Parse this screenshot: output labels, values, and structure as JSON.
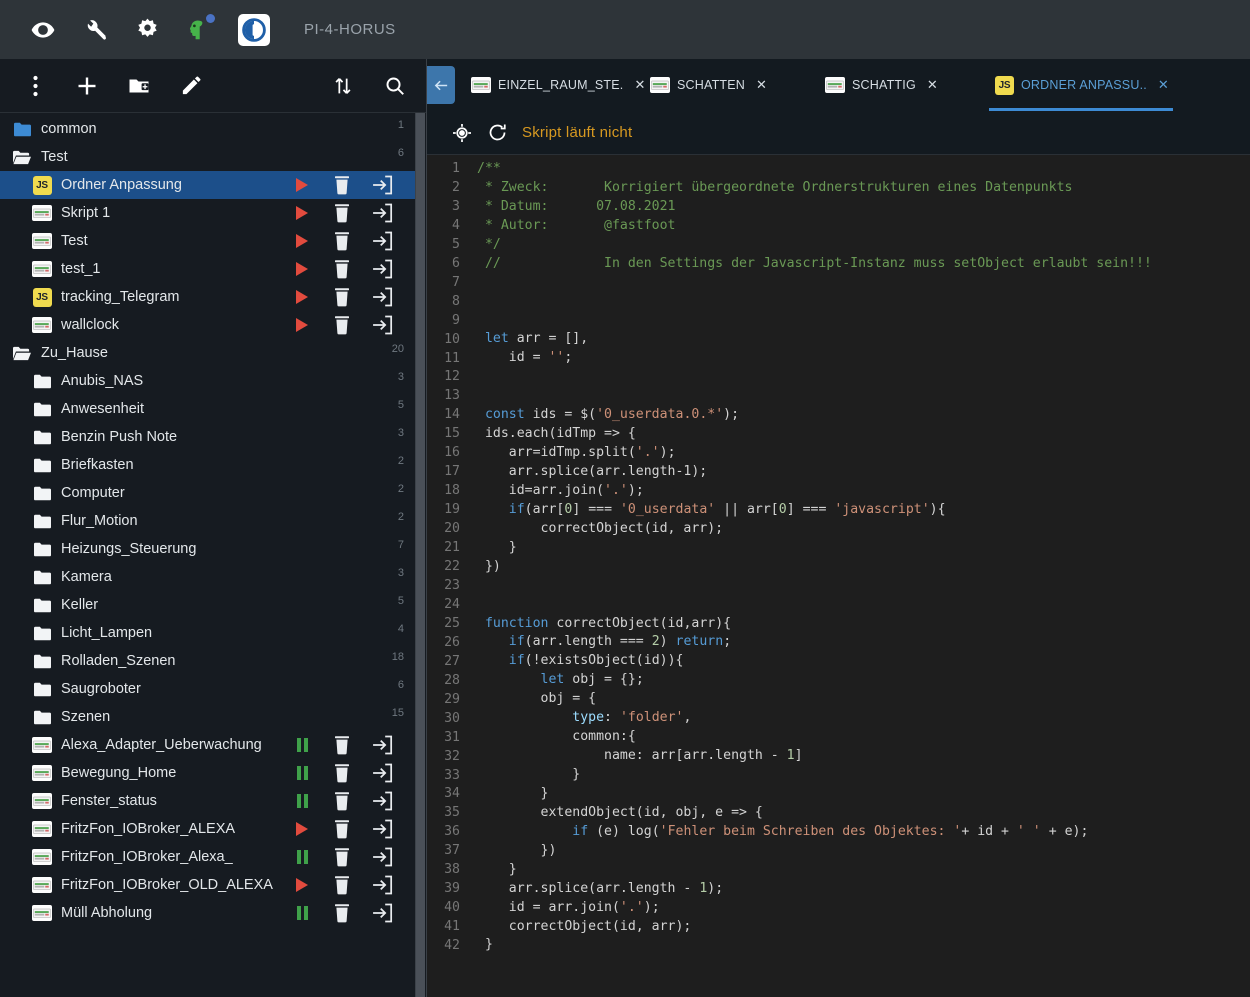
{
  "appbar": {
    "title": "PI-4-HORUS",
    "icons": [
      {
        "name": "eye-icon",
        "label": "eye"
      },
      {
        "name": "wrench-icon",
        "label": "wrench"
      },
      {
        "name": "gear-icon",
        "label": "gear"
      },
      {
        "name": "brain-icon",
        "label": "expert-mode"
      }
    ],
    "logo_label": "iobroker-logo"
  },
  "sidebar": {
    "toolbar": [
      {
        "name": "more-vert-icon",
        "label": "More options"
      },
      {
        "name": "add-icon",
        "label": "Add script"
      },
      {
        "name": "add-folder-icon",
        "label": "New folder"
      },
      {
        "name": "edit-icon",
        "label": "Rename"
      },
      {
        "name": "sort-icon",
        "label": "Sort"
      },
      {
        "name": "search-icon",
        "label": "Search"
      }
    ],
    "tree": [
      {
        "label": "common",
        "type": "folder-closed",
        "depth": 0,
        "count": "1",
        "actions": []
      },
      {
        "label": "Test",
        "type": "folder-open",
        "depth": 0,
        "count": "6",
        "actions": []
      },
      {
        "label": "Ordner Anpassung",
        "type": "js",
        "depth": 1,
        "count": "",
        "selected": true,
        "actions": [
          "play",
          "delete",
          "export"
        ]
      },
      {
        "label": "Skript 1",
        "type": "blockly",
        "depth": 1,
        "count": "",
        "actions": [
          "play",
          "delete",
          "export"
        ]
      },
      {
        "label": "Test",
        "type": "blockly",
        "depth": 1,
        "count": "",
        "actions": [
          "play",
          "delete",
          "export"
        ]
      },
      {
        "label": "test_1",
        "type": "blockly",
        "depth": 1,
        "count": "",
        "actions": [
          "play",
          "delete",
          "export"
        ]
      },
      {
        "label": "tracking_Telegram",
        "type": "js",
        "depth": 1,
        "count": "",
        "actions": [
          "play",
          "delete",
          "export"
        ]
      },
      {
        "label": "wallclock",
        "type": "blockly",
        "depth": 1,
        "count": "",
        "actions": [
          "play",
          "delete",
          "export"
        ]
      },
      {
        "label": "Zu_Hause",
        "type": "folder-open",
        "depth": 0,
        "count": "20",
        "actions": []
      },
      {
        "label": "Anubis_NAS",
        "type": "folder-closed-white",
        "depth": 1,
        "count": "3",
        "actions": []
      },
      {
        "label": "Anwesenheit",
        "type": "folder-closed-white",
        "depth": 1,
        "count": "5",
        "actions": []
      },
      {
        "label": "Benzin Push Note",
        "type": "folder-closed-white",
        "depth": 1,
        "count": "3",
        "actions": []
      },
      {
        "label": "Briefkasten",
        "type": "folder-closed-white",
        "depth": 1,
        "count": "2",
        "actions": []
      },
      {
        "label": "Computer",
        "type": "folder-closed-white",
        "depth": 1,
        "count": "2",
        "actions": []
      },
      {
        "label": "Flur_Motion",
        "type": "folder-closed-white",
        "depth": 1,
        "count": "2",
        "actions": []
      },
      {
        "label": "Heizungs_Steuerung",
        "type": "folder-closed-white",
        "depth": 1,
        "count": "7",
        "actions": []
      },
      {
        "label": "Kamera",
        "type": "folder-closed-white",
        "depth": 1,
        "count": "3",
        "actions": []
      },
      {
        "label": "Keller",
        "type": "folder-closed-white",
        "depth": 1,
        "count": "5",
        "actions": []
      },
      {
        "label": "Licht_Lampen",
        "type": "folder-closed-white",
        "depth": 1,
        "count": "4",
        "actions": []
      },
      {
        "label": "Rolladen_Szenen",
        "type": "folder-closed-white",
        "depth": 1,
        "count": "18",
        "actions": []
      },
      {
        "label": "Saugroboter",
        "type": "folder-closed-white",
        "depth": 1,
        "count": "6",
        "actions": []
      },
      {
        "label": "Szenen",
        "type": "folder-closed-white",
        "depth": 1,
        "count": "15",
        "actions": []
      },
      {
        "label": "Alexa_Adapter_Ueberwachung",
        "type": "blockly",
        "depth": 1,
        "count": "",
        "actions": [
          "pause",
          "delete",
          "export"
        ]
      },
      {
        "label": "Bewegung_Home",
        "type": "blockly",
        "depth": 1,
        "count": "",
        "actions": [
          "pause",
          "delete",
          "export"
        ]
      },
      {
        "label": "Fenster_status",
        "type": "blockly",
        "depth": 1,
        "count": "",
        "actions": [
          "pause",
          "delete",
          "export"
        ]
      },
      {
        "label": "FritzFon_IOBroker_ALEXA",
        "type": "blockly",
        "depth": 1,
        "count": "",
        "actions": [
          "play",
          "delete",
          "export"
        ]
      },
      {
        "label": "FritzFon_IOBroker_Alexa_",
        "type": "blockly",
        "depth": 1,
        "count": "",
        "actions": [
          "pause",
          "delete",
          "export"
        ]
      },
      {
        "label": "FritzFon_IOBroker_OLD_ALEXA",
        "type": "blockly",
        "depth": 1,
        "count": "",
        "actions": [
          "play",
          "delete",
          "export"
        ]
      },
      {
        "label": "Müll Abholung",
        "type": "blockly",
        "depth": 1,
        "count": "",
        "actions": [
          "pause",
          "delete",
          "export"
        ]
      }
    ]
  },
  "editor": {
    "back_label": "←",
    "tabs": [
      {
        "label": "EINZEL_RAUM_STE.",
        "icon": "blockly",
        "close": "✕",
        "active": false
      },
      {
        "label": "SCHATTEN",
        "icon": "blockly",
        "close": "✕",
        "active": false
      },
      {
        "label": "SCHATTIG",
        "icon": "blockly",
        "close": "✕",
        "active": false
      },
      {
        "label": "ORDNER ANPASSU..",
        "icon": "js",
        "close": "✕",
        "active": true
      }
    ],
    "run_status": "Skript läuft nicht",
    "run_icons": [
      {
        "name": "debug-target-icon"
      },
      {
        "name": "restart-icon"
      }
    ],
    "code": {
      "first_line": 1,
      "lines": [
        {
          "n": 1,
          "tokens": [
            {
              "t": "/**",
              "c": "cm"
            }
          ]
        },
        {
          "n": 2,
          "tokens": [
            {
              "t": " * Zweck:       Korrigiert übergeordnete Ordnerstrukturen eines Datenpunkts",
              "c": "cm"
            }
          ]
        },
        {
          "n": 3,
          "tokens": [
            {
              "t": " * Datum:      07.08.2021",
              "c": "cm"
            }
          ]
        },
        {
          "n": 4,
          "tokens": [
            {
              "t": " * Autor:       @fastfoot",
              "c": "cm"
            }
          ]
        },
        {
          "n": 5,
          "tokens": [
            {
              "t": " */",
              "c": "cm"
            }
          ]
        },
        {
          "n": 6,
          "tokens": [
            {
              "t": " //             In den Settings der Javascript-Instanz muss setObject erlaubt sein!!!",
              "c": "cm"
            }
          ]
        },
        {
          "n": 7,
          "tokens": []
        },
        {
          "n": 8,
          "tokens": []
        },
        {
          "n": 9,
          "tokens": []
        },
        {
          "n": 10,
          "tokens": [
            {
              "t": " let",
              "c": "kw"
            },
            {
              "t": " arr = [],",
              "c": "op"
            }
          ]
        },
        {
          "n": 11,
          "tokens": [
            {
              "t": "    id = ",
              "c": "op"
            },
            {
              "t": "''",
              "c": "st"
            },
            {
              "t": ";",
              "c": "op"
            }
          ]
        },
        {
          "n": 12,
          "tokens": []
        },
        {
          "n": 13,
          "tokens": []
        },
        {
          "n": 14,
          "tokens": [
            {
              "t": " const",
              "c": "kw"
            },
            {
              "t": " ids = $(",
              "c": "op"
            },
            {
              "t": "'0_userdata.0.*'",
              "c": "st"
            },
            {
              "t": ");",
              "c": "op"
            }
          ]
        },
        {
          "n": 15,
          "tokens": [
            {
              "t": " ids.each(idTmp => {",
              "c": "op"
            }
          ]
        },
        {
          "n": 16,
          "tokens": [
            {
              "t": "    arr=idTmp.split(",
              "c": "op"
            },
            {
              "t": "'.'",
              "c": "st"
            },
            {
              "t": ");",
              "c": "op"
            }
          ]
        },
        {
          "n": 17,
          "tokens": [
            {
              "t": "    arr.splice(arr.length-1);",
              "c": "op"
            }
          ]
        },
        {
          "n": 18,
          "tokens": [
            {
              "t": "    id=arr.join(",
              "c": "op"
            },
            {
              "t": "'.'",
              "c": "st"
            },
            {
              "t": ");",
              "c": "op"
            }
          ]
        },
        {
          "n": 19,
          "tokens": [
            {
              "t": "    ",
              "c": "op"
            },
            {
              "t": "if",
              "c": "kw"
            },
            {
              "t": "(arr[",
              "c": "op"
            },
            {
              "t": "0",
              "c": "nm"
            },
            {
              "t": "] === ",
              "c": "op"
            },
            {
              "t": "'0_userdata'",
              "c": "st"
            },
            {
              "t": " || arr[",
              "c": "op"
            },
            {
              "t": "0",
              "c": "nm"
            },
            {
              "t": "] === ",
              "c": "op"
            },
            {
              "t": "'javascript'",
              "c": "st"
            },
            {
              "t": "){",
              "c": "op"
            }
          ]
        },
        {
          "n": 20,
          "tokens": [
            {
              "t": "        correctObject(id, arr);",
              "c": "op"
            }
          ]
        },
        {
          "n": 21,
          "tokens": [
            {
              "t": "    }",
              "c": "op"
            }
          ]
        },
        {
          "n": 22,
          "tokens": [
            {
              "t": " })",
              "c": "op"
            }
          ]
        },
        {
          "n": 23,
          "tokens": []
        },
        {
          "n": 24,
          "tokens": []
        },
        {
          "n": 25,
          "tokens": [
            {
              "t": " function",
              "c": "kw"
            },
            {
              "t": " correctObject(id,arr){",
              "c": "op"
            }
          ]
        },
        {
          "n": 26,
          "tokens": [
            {
              "t": "    ",
              "c": "op"
            },
            {
              "t": "if",
              "c": "kw"
            },
            {
              "t": "(arr.length === ",
              "c": "op"
            },
            {
              "t": "2",
              "c": "nm"
            },
            {
              "t": ") ",
              "c": "op"
            },
            {
              "t": "return",
              "c": "kw"
            },
            {
              "t": ";",
              "c": "op"
            }
          ]
        },
        {
          "n": 27,
          "tokens": [
            {
              "t": "    ",
              "c": "op"
            },
            {
              "t": "if",
              "c": "kw"
            },
            {
              "t": "(!existsObject(id)){",
              "c": "op"
            }
          ]
        },
        {
          "n": 28,
          "tokens": [
            {
              "t": "        ",
              "c": "op"
            },
            {
              "t": "let",
              "c": "kw"
            },
            {
              "t": " obj = {};",
              "c": "op"
            }
          ]
        },
        {
          "n": 29,
          "tokens": [
            {
              "t": "        obj = {",
              "c": "op"
            }
          ]
        },
        {
          "n": 30,
          "tokens": [
            {
              "t": "            ",
              "c": "op"
            },
            {
              "t": "type",
              "c": "pr"
            },
            {
              "t": ": ",
              "c": "op"
            },
            {
              "t": "'folder'",
              "c": "st"
            },
            {
              "t": ",",
              "c": "op"
            }
          ]
        },
        {
          "n": 31,
          "tokens": [
            {
              "t": "            common:{",
              "c": "op"
            }
          ]
        },
        {
          "n": 32,
          "tokens": [
            {
              "t": "                name: arr[arr.length - ",
              "c": "op"
            },
            {
              "t": "1",
              "c": "nm"
            },
            {
              "t": "]",
              "c": "op"
            }
          ]
        },
        {
          "n": 33,
          "tokens": [
            {
              "t": "            }",
              "c": "op"
            }
          ]
        },
        {
          "n": 34,
          "tokens": [
            {
              "t": "        }",
              "c": "op"
            }
          ]
        },
        {
          "n": 35,
          "tokens": [
            {
              "t": "        extendObject(id, obj, e => {",
              "c": "op"
            }
          ]
        },
        {
          "n": 36,
          "tokens": [
            {
              "t": "            ",
              "c": "op"
            },
            {
              "t": "if",
              "c": "kw"
            },
            {
              "t": " (e) log(",
              "c": "op"
            },
            {
              "t": "'Fehler beim Schreiben des Objektes: '",
              "c": "st"
            },
            {
              "t": "+ id + ",
              "c": "op"
            },
            {
              "t": "' '",
              "c": "st"
            },
            {
              "t": " + e);",
              "c": "op"
            }
          ]
        },
        {
          "n": 37,
          "tokens": [
            {
              "t": "        })",
              "c": "op"
            }
          ]
        },
        {
          "n": 38,
          "tokens": [
            {
              "t": "    }",
              "c": "op"
            }
          ]
        },
        {
          "n": 39,
          "tokens": [
            {
              "t": "    arr.splice(arr.length - ",
              "c": "op"
            },
            {
              "t": "1",
              "c": "nm"
            },
            {
              "t": ");",
              "c": "op"
            }
          ]
        },
        {
          "n": 40,
          "tokens": [
            {
              "t": "    id = arr.join(",
              "c": "op"
            },
            {
              "t": "'.'",
              "c": "st"
            },
            {
              "t": ");",
              "c": "op"
            }
          ]
        },
        {
          "n": 41,
          "tokens": [
            {
              "t": "    correctObject(id, arr);",
              "c": "op"
            }
          ]
        },
        {
          "n": 42,
          "tokens": [
            {
              "t": " }",
              "c": "op"
            }
          ]
        }
      ]
    }
  },
  "colors": {
    "accent_blue": "#3d8bd4",
    "selected_row": "#1c4f8a",
    "run_status": "#d79921",
    "play_red": "#e24b3e",
    "pause_green": "#3fa14a",
    "js_yellow": "#f0db4f",
    "folder_blue": "#3d8bd4"
  }
}
